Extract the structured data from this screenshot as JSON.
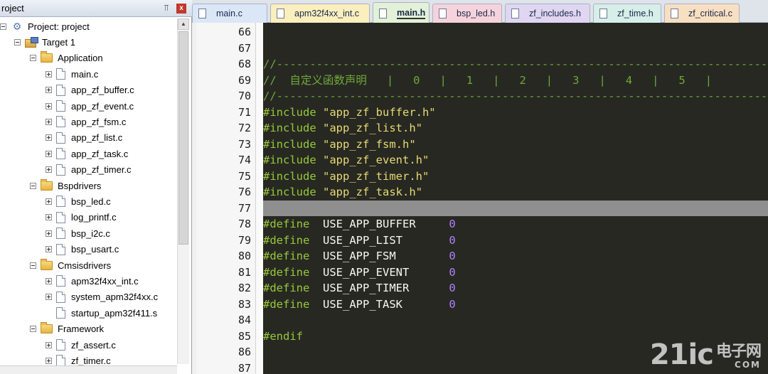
{
  "project_panel": {
    "title": "roject",
    "pin_icon": "pin-icon",
    "close_label": "x",
    "tree": [
      {
        "label": "Project: project",
        "kind": "project",
        "level": 0,
        "expander": "minus"
      },
      {
        "label": "Target 1",
        "kind": "target",
        "level": 1,
        "expander": "minus"
      },
      {
        "label": "Application",
        "kind": "folder",
        "level": 2,
        "expander": "minus"
      },
      {
        "label": "main.c",
        "kind": "file",
        "level": 3,
        "expander": "plus"
      },
      {
        "label": "app_zf_buffer.c",
        "kind": "file",
        "level": 3,
        "expander": "plus"
      },
      {
        "label": "app_zf_event.c",
        "kind": "file",
        "level": 3,
        "expander": "plus"
      },
      {
        "label": "app_zf_fsm.c",
        "kind": "file",
        "level": 3,
        "expander": "plus"
      },
      {
        "label": "app_zf_list.c",
        "kind": "file",
        "level": 3,
        "expander": "plus"
      },
      {
        "label": "app_zf_task.c",
        "kind": "file",
        "level": 3,
        "expander": "plus"
      },
      {
        "label": "app_zf_timer.c",
        "kind": "file",
        "level": 3,
        "expander": "plus"
      },
      {
        "label": "Bspdrivers",
        "kind": "folder",
        "level": 2,
        "expander": "minus"
      },
      {
        "label": "bsp_led.c",
        "kind": "file",
        "level": 3,
        "expander": "plus"
      },
      {
        "label": "log_printf.c",
        "kind": "file",
        "level": 3,
        "expander": "plus"
      },
      {
        "label": "bsp_i2c.c",
        "kind": "file",
        "level": 3,
        "expander": "plus"
      },
      {
        "label": "bsp_usart.c",
        "kind": "file",
        "level": 3,
        "expander": "plus"
      },
      {
        "label": "Cmsisdrivers",
        "kind": "folder",
        "level": 2,
        "expander": "minus"
      },
      {
        "label": "apm32f4xx_int.c",
        "kind": "file",
        "level": 3,
        "expander": "plus"
      },
      {
        "label": "system_apm32f4xx.c",
        "kind": "file",
        "level": 3,
        "expander": "plus"
      },
      {
        "label": "startup_apm32f411.s",
        "kind": "file",
        "level": 3,
        "expander": "none"
      },
      {
        "label": "Framework",
        "kind": "folder",
        "level": 2,
        "expander": "minus"
      },
      {
        "label": "zf_assert.c",
        "kind": "file",
        "level": 3,
        "expander": "plus"
      },
      {
        "label": "zf_timer.c",
        "kind": "file",
        "level": 3,
        "expander": "plus"
      }
    ]
  },
  "tabs": [
    {
      "label": "main.c",
      "color": "#dbe7f7",
      "active": false
    },
    {
      "label": "apm32f4xx_int.c",
      "color": "#fbefbd",
      "active": false
    },
    {
      "label": "main.h",
      "color": "#e2f1d7",
      "active": true
    },
    {
      "label": "bsp_led.h",
      "color": "#f6d3dc",
      "active": false
    },
    {
      "label": "zf_includes.h",
      "color": "#e0d6f2",
      "active": false
    },
    {
      "label": "zf_time.h",
      "color": "#d7eee9",
      "active": false
    },
    {
      "label": "zf_critical.c",
      "color": "#f9dfc2",
      "active": false
    }
  ],
  "editor": {
    "current_line": 77,
    "lines": [
      {
        "no": "66",
        "parts": []
      },
      {
        "no": "67",
        "parts": []
      },
      {
        "no": "68",
        "parts": [
          {
            "t": "//-------------------------------------------------------------------------------------------------------",
            "c": "c-comment"
          }
        ]
      },
      {
        "no": "69",
        "parts": [
          {
            "t": "//  自定义函数声明   |   0   |   1   |   2   |   3   |   4   |   5   |",
            "c": "c-comment"
          }
        ]
      },
      {
        "no": "70",
        "parts": [
          {
            "t": "//-------------------------------------------------------------------------------------------------------",
            "c": "c-comment"
          }
        ]
      },
      {
        "no": "71",
        "parts": [
          {
            "t": "#include ",
            "c": "c-pre"
          },
          {
            "t": "\"app_zf_buffer.h\"",
            "c": "c-str"
          }
        ]
      },
      {
        "no": "72",
        "parts": [
          {
            "t": "#include ",
            "c": "c-pre"
          },
          {
            "t": "\"app_zf_list.h\"",
            "c": "c-str"
          }
        ]
      },
      {
        "no": "73",
        "parts": [
          {
            "t": "#include ",
            "c": "c-pre"
          },
          {
            "t": "\"app_zf_fsm.h\"",
            "c": "c-str"
          }
        ]
      },
      {
        "no": "74",
        "parts": [
          {
            "t": "#include ",
            "c": "c-pre"
          },
          {
            "t": "\"app_zf_event.h\"",
            "c": "c-str"
          }
        ]
      },
      {
        "no": "75",
        "parts": [
          {
            "t": "#include ",
            "c": "c-pre"
          },
          {
            "t": "\"app_zf_timer.h\"",
            "c": "c-str"
          }
        ]
      },
      {
        "no": "76",
        "parts": [
          {
            "t": "#include ",
            "c": "c-pre"
          },
          {
            "t": "\"app_zf_task.h\"",
            "c": "c-str"
          }
        ]
      },
      {
        "no": "77",
        "parts": []
      },
      {
        "no": "78",
        "parts": [
          {
            "t": "#define  ",
            "c": "c-pre"
          },
          {
            "t": "USE_APP_BUFFER     ",
            "c": "c-ident"
          },
          {
            "t": "0",
            "c": "c-num"
          }
        ]
      },
      {
        "no": "79",
        "parts": [
          {
            "t": "#define  ",
            "c": "c-pre"
          },
          {
            "t": "USE_APP_LIST       ",
            "c": "c-ident"
          },
          {
            "t": "0",
            "c": "c-num"
          }
        ]
      },
      {
        "no": "80",
        "parts": [
          {
            "t": "#define  ",
            "c": "c-pre"
          },
          {
            "t": "USE_APP_FSM        ",
            "c": "c-ident"
          },
          {
            "t": "0",
            "c": "c-num"
          }
        ]
      },
      {
        "no": "81",
        "parts": [
          {
            "t": "#define  ",
            "c": "c-pre"
          },
          {
            "t": "USE_APP_EVENT      ",
            "c": "c-ident"
          },
          {
            "t": "0",
            "c": "c-num"
          }
        ]
      },
      {
        "no": "82",
        "parts": [
          {
            "t": "#define  ",
            "c": "c-pre"
          },
          {
            "t": "USE_APP_TIMER      ",
            "c": "c-ident"
          },
          {
            "t": "0",
            "c": "c-num"
          }
        ]
      },
      {
        "no": "83",
        "parts": [
          {
            "t": "#define  ",
            "c": "c-pre"
          },
          {
            "t": "USE_APP_TASK       ",
            "c": "c-ident"
          },
          {
            "t": "0",
            "c": "c-num"
          }
        ]
      },
      {
        "no": "84",
        "parts": []
      },
      {
        "no": "85",
        "parts": [
          {
            "t": "#endif",
            "c": "c-pre"
          }
        ]
      },
      {
        "no": "86",
        "parts": []
      },
      {
        "no": "87",
        "parts": []
      }
    ]
  },
  "watermark": {
    "brand": "21ic",
    "sub": "电子网",
    "dots": "COM"
  }
}
